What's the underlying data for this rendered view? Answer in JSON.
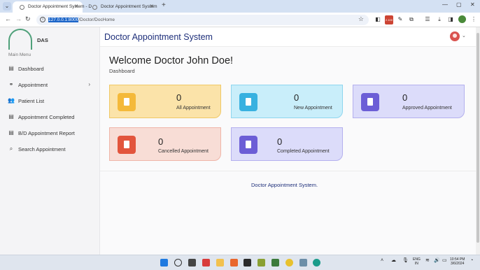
{
  "browser": {
    "tabs": [
      {
        "title": "Doctor Appointment System - D",
        "active": true
      },
      {
        "title": "Doctor Appointment System",
        "active": false
      }
    ],
    "url_host": "127.0.0.1:8000",
    "url_path": "/Doctor/DocHome",
    "profile_initial": "",
    "badge": "2.100"
  },
  "sidebar": {
    "logo_text": "DAS",
    "menu_title": "Main Menu",
    "items": [
      {
        "label": "Dashboard",
        "icon": "file-icon"
      },
      {
        "label": "Appointment",
        "icon": "handshake-icon",
        "has_submenu": true
      },
      {
        "label": "Patient List",
        "icon": "users-icon"
      },
      {
        "label": "Appointment Completed",
        "icon": "file-icon"
      },
      {
        "label": "B/D Appointment Report",
        "icon": "file-icon"
      },
      {
        "label": "Search Appointment",
        "icon": "search-icon"
      }
    ]
  },
  "header": {
    "brand": "Doctor Appointment System"
  },
  "main": {
    "welcome": "Welcome Doctor John Doe!",
    "breadcrumb": "Dashboard",
    "cards": [
      {
        "count": "0",
        "label": "All Appointment",
        "color": "#f4b93a"
      },
      {
        "count": "0",
        "label": "New Appointment",
        "color": "#38b1e0"
      },
      {
        "count": "0",
        "label": "Approved Appointment",
        "color": "#6c5ed6"
      },
      {
        "count": "0",
        "label": "Cancelled Appointment",
        "color": "#e2553d"
      },
      {
        "count": "0",
        "label": "Completed Appointment",
        "color": "#6c5ed6"
      }
    ],
    "footer": "Doctor Appointment System."
  },
  "taskbar": {
    "lang": "ENG",
    "region": "IN",
    "time": "10:54 PM",
    "date": "3/6/2024"
  }
}
